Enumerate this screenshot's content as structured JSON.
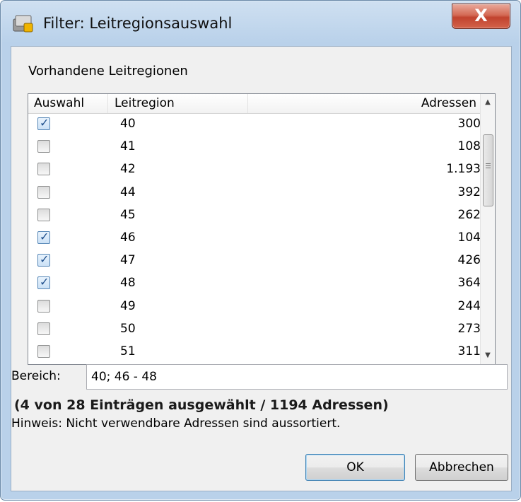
{
  "window": {
    "title": "Filter: Leitregionsauswahl",
    "close_label": "X"
  },
  "group_label": "Vorhandene Leitregionen",
  "list": {
    "columns": {
      "select": "Auswahl",
      "region": "Leitregion",
      "addresses": "Adressen"
    },
    "rows": [
      {
        "checked": true,
        "region": "40",
        "addresses": "300"
      },
      {
        "checked": false,
        "region": "41",
        "addresses": "108"
      },
      {
        "checked": false,
        "region": "42",
        "addresses": "1.193"
      },
      {
        "checked": false,
        "region": "44",
        "addresses": "392"
      },
      {
        "checked": false,
        "region": "45",
        "addresses": "262"
      },
      {
        "checked": true,
        "region": "46",
        "addresses": "104"
      },
      {
        "checked": true,
        "region": "47",
        "addresses": "426"
      },
      {
        "checked": true,
        "region": "48",
        "addresses": "364"
      },
      {
        "checked": false,
        "region": "49",
        "addresses": "244"
      },
      {
        "checked": false,
        "region": "50",
        "addresses": "273"
      },
      {
        "checked": false,
        "region": "51",
        "addresses": "311"
      }
    ]
  },
  "range": {
    "label": "Bereich:",
    "value": "40; 46 - 48"
  },
  "status_text": "(4 von 28 Einträgen ausgewählt / 1194 Adressen)",
  "hint_text": "Hinweis: Nicht verwendbare Adressen sind aussortiert.",
  "buttons": {
    "ok": "OK",
    "cancel": "Abbrechen"
  },
  "icons": {
    "app": "app-filter-icon",
    "close": "close-icon",
    "check": "checkmark-icon"
  }
}
